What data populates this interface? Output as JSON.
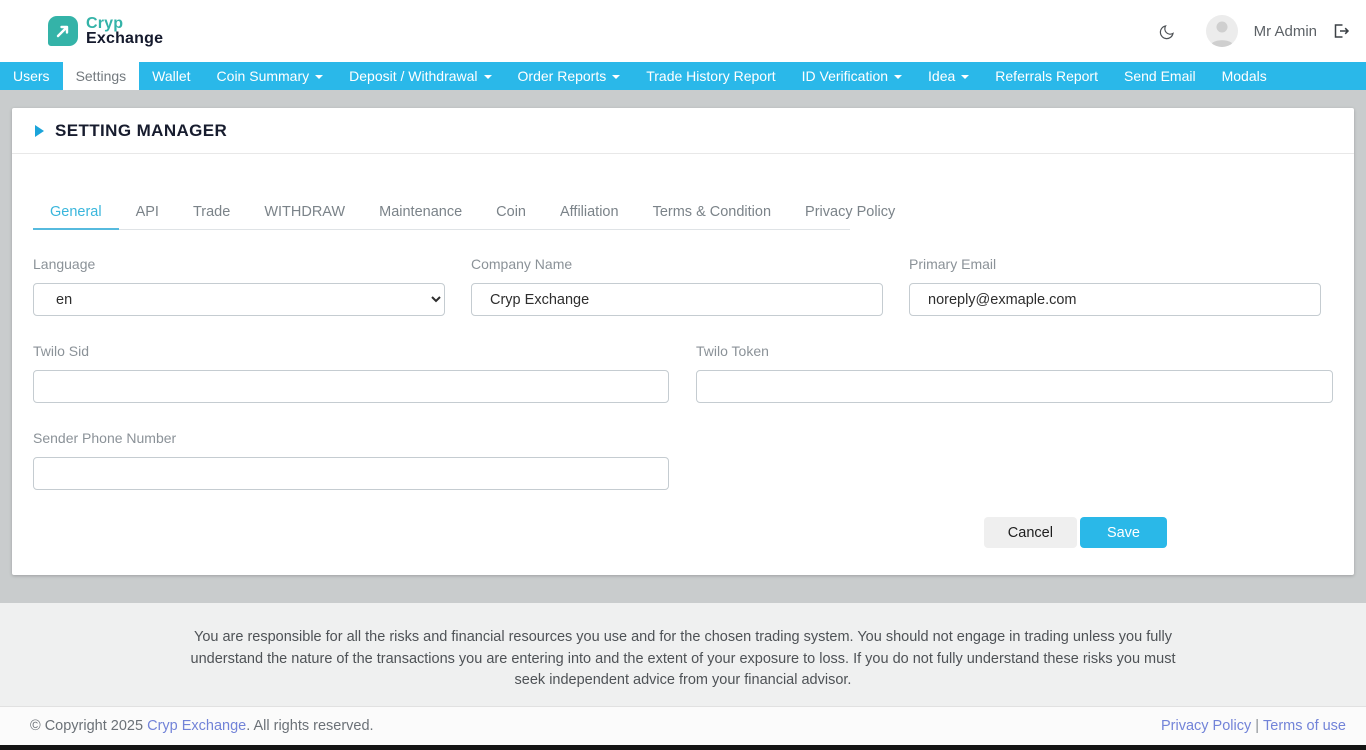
{
  "header": {
    "logo_line1": "Cryp",
    "logo_line2": "Exchange",
    "user_name": "Mr Admin"
  },
  "navbar": {
    "items": [
      {
        "label": "Users",
        "active": false,
        "caret": false
      },
      {
        "label": "Settings",
        "active": true,
        "caret": false
      },
      {
        "label": "Wallet",
        "active": false,
        "caret": false
      },
      {
        "label": "Coin Summary",
        "active": false,
        "caret": true
      },
      {
        "label": "Deposit / Withdrawal",
        "active": false,
        "caret": true
      },
      {
        "label": "Order Reports",
        "active": false,
        "caret": true
      },
      {
        "label": "Trade History Report",
        "active": false,
        "caret": false
      },
      {
        "label": "ID Verification",
        "active": false,
        "caret": true
      },
      {
        "label": "Idea",
        "active": false,
        "caret": true
      },
      {
        "label": "Referrals Report",
        "active": false,
        "caret": false
      },
      {
        "label": "Send Email",
        "active": false,
        "caret": false
      },
      {
        "label": "Modals",
        "active": false,
        "caret": false
      }
    ]
  },
  "panel": {
    "title": "SETTING MANAGER",
    "tabs": [
      {
        "label": "General",
        "active": true
      },
      {
        "label": "API",
        "active": false
      },
      {
        "label": "Trade",
        "active": false
      },
      {
        "label": "WITHDRAW",
        "active": false
      },
      {
        "label": "Maintenance",
        "active": false
      },
      {
        "label": "Coin",
        "active": false
      },
      {
        "label": "Affiliation",
        "active": false
      },
      {
        "label": "Terms & Condition",
        "active": false
      },
      {
        "label": "Privacy Policy",
        "active": false
      }
    ],
    "form": {
      "language": {
        "label": "Language",
        "value": "en"
      },
      "company_name": {
        "label": "Company Name",
        "value": "Cryp Exchange"
      },
      "primary_email": {
        "label": "Primary Email",
        "value": "noreply@exmaple.com"
      },
      "twilo_sid": {
        "label": "Twilo Sid",
        "value": ""
      },
      "twilo_token": {
        "label": "Twilo Token",
        "value": ""
      },
      "sender_phone": {
        "label": "Sender Phone Number",
        "value": ""
      }
    },
    "buttons": {
      "cancel": "Cancel",
      "save": "Save"
    }
  },
  "footer": {
    "disclaimer": "You are responsible for all the risks and financial resources you use and for the chosen trading system. You should not engage in trading unless you fully understand the nature of the transactions you are entering into and the extent of your exposure to loss. If you do not fully understand these risks you must seek independent advice from your financial advisor.",
    "copyright_prefix": "© Copyright 2025",
    "copyright_link": "Cryp Exchange",
    "copyright_suffix": ". All rights reserved.",
    "privacy_link": "Privacy Policy",
    "separator": "|",
    "terms_link": "Terms of use"
  },
  "colors": {
    "navbar": "#2ab8e9",
    "accent": "#3ab6dc",
    "brand_teal": "#34b3a8",
    "save_button": "#2ab8e8",
    "link": "#7283d8",
    "content_bg": "#c9cccd"
  }
}
